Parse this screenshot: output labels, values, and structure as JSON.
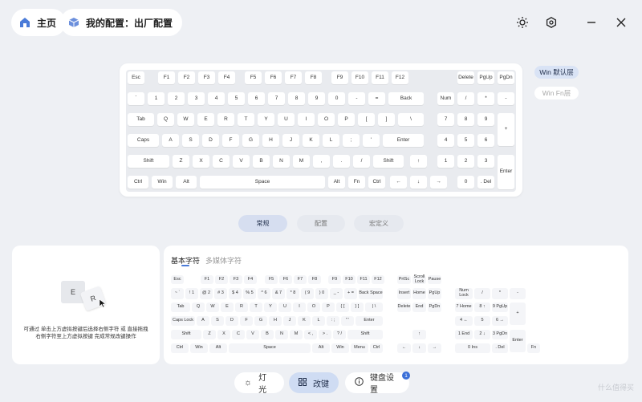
{
  "header": {
    "home_label": "主页",
    "config_label": "我的配置：出厂配置"
  },
  "layers": {
    "win_default": "Win 默认层",
    "win_fn": "Win Fn层"
  },
  "mode_tabs": [
    "常规",
    "配置",
    "宏定义"
  ],
  "panel_tabs": {
    "basic": "基本字符",
    "media": "多媒体字符"
  },
  "instruction": {
    "line1": "可通过 单击上方虚拟按键后选择右侧字符 或 直接拖拽",
    "line2": "右侧字符至上方虚拟按键 完成常规改键操作",
    "key_e": "E",
    "key_r": "R"
  },
  "bottom": {
    "lighting": "灯光",
    "remap": "改键",
    "settings": "键盘设置",
    "badge": "1"
  },
  "watermark": "什么值得买",
  "colors": {
    "accent": "#d8e2f5",
    "active_text": "#1f2d4a"
  },
  "icons": [
    "home-icon",
    "cube-icon",
    "sun-icon",
    "settings-icon",
    "minimize-icon",
    "close-icon",
    "lighting-icon",
    "remap-icon",
    "info-icon"
  ],
  "virtual_keyboard": [
    "Esc",
    "F1",
    "F2",
    "F3",
    "F4",
    "F5",
    "F6",
    "F7",
    "F8",
    "F9",
    "F10",
    "F11",
    "F12",
    "Delete",
    "PgUp",
    "PgDn",
    "`",
    "1",
    "2",
    "3",
    "4",
    "5",
    "6",
    "7",
    "8",
    "9",
    "0",
    "-",
    "=",
    "Back",
    "Num",
    "/",
    "*",
    "-",
    "Tab",
    "Q",
    "W",
    "E",
    "R",
    "T",
    "Y",
    "U",
    "I",
    "O",
    "P",
    "[",
    "]",
    "\\",
    "7",
    "8",
    "9",
    "+",
    "Caps",
    "A",
    "S",
    "D",
    "F",
    "G",
    "H",
    "J",
    "K",
    "L",
    ";",
    "'",
    "Enter",
    "4",
    "5",
    "6",
    "Shift",
    "Z",
    "X",
    "C",
    "V",
    "B",
    "N",
    "M",
    ",",
    ".",
    "/",
    "Shift",
    "↑",
    "1",
    "2",
    "3",
    "Enter",
    "Ctrl",
    "Win",
    "Alt",
    "Space",
    "Alt",
    "Fn",
    "Ctrl",
    "←",
    "↓",
    "→",
    "0",
    ". Del"
  ],
  "char_keyboard": [
    "Esc",
    "F1",
    "F2",
    "F3",
    "F4",
    "F5",
    "F6",
    "F7",
    "F8",
    "F9",
    "F10",
    "F11",
    "F12",
    "PrtSc",
    "Scroll Lock",
    "Pause",
    "~ `",
    "! 1",
    "@ 2",
    "# 3",
    "$ 4",
    "% 5",
    "^ 6",
    "& 7",
    "* 8",
    "( 9",
    ") 0",
    "_ -",
    "+ =",
    "Back Space",
    "Insert",
    "Home",
    "PgUp",
    "Num Lock",
    "/",
    "*",
    "-",
    "Tab",
    "Q",
    "W",
    "E",
    "R",
    "T",
    "Y",
    "U",
    "I",
    "O",
    "P",
    "{ [",
    "} ]",
    "| \\",
    "Delete",
    "End",
    "PgDn",
    "7 Home",
    "8 ↑",
    "9 PgUp",
    "+",
    "Caps Lock",
    "A",
    "S",
    "D",
    "F",
    "G",
    "H",
    "J",
    "K",
    "L",
    ": ;",
    "\" '",
    "Enter",
    "4 ←",
    "5",
    "6 →",
    "Shift",
    "Z",
    "X",
    "C",
    "V",
    "B",
    "N",
    "M",
    "< ,",
    "> .",
    "? /",
    "Shift",
    "↑",
    "1 End",
    "2 ↓",
    "3 PgDn",
    "Enter",
    "Ctrl",
    "Win",
    "Alt",
    "Space",
    "Alt",
    "Win",
    "Menu",
    "Ctrl",
    "←",
    "↓",
    "→",
    "0 Ins",
    ". Del",
    "Fn"
  ]
}
